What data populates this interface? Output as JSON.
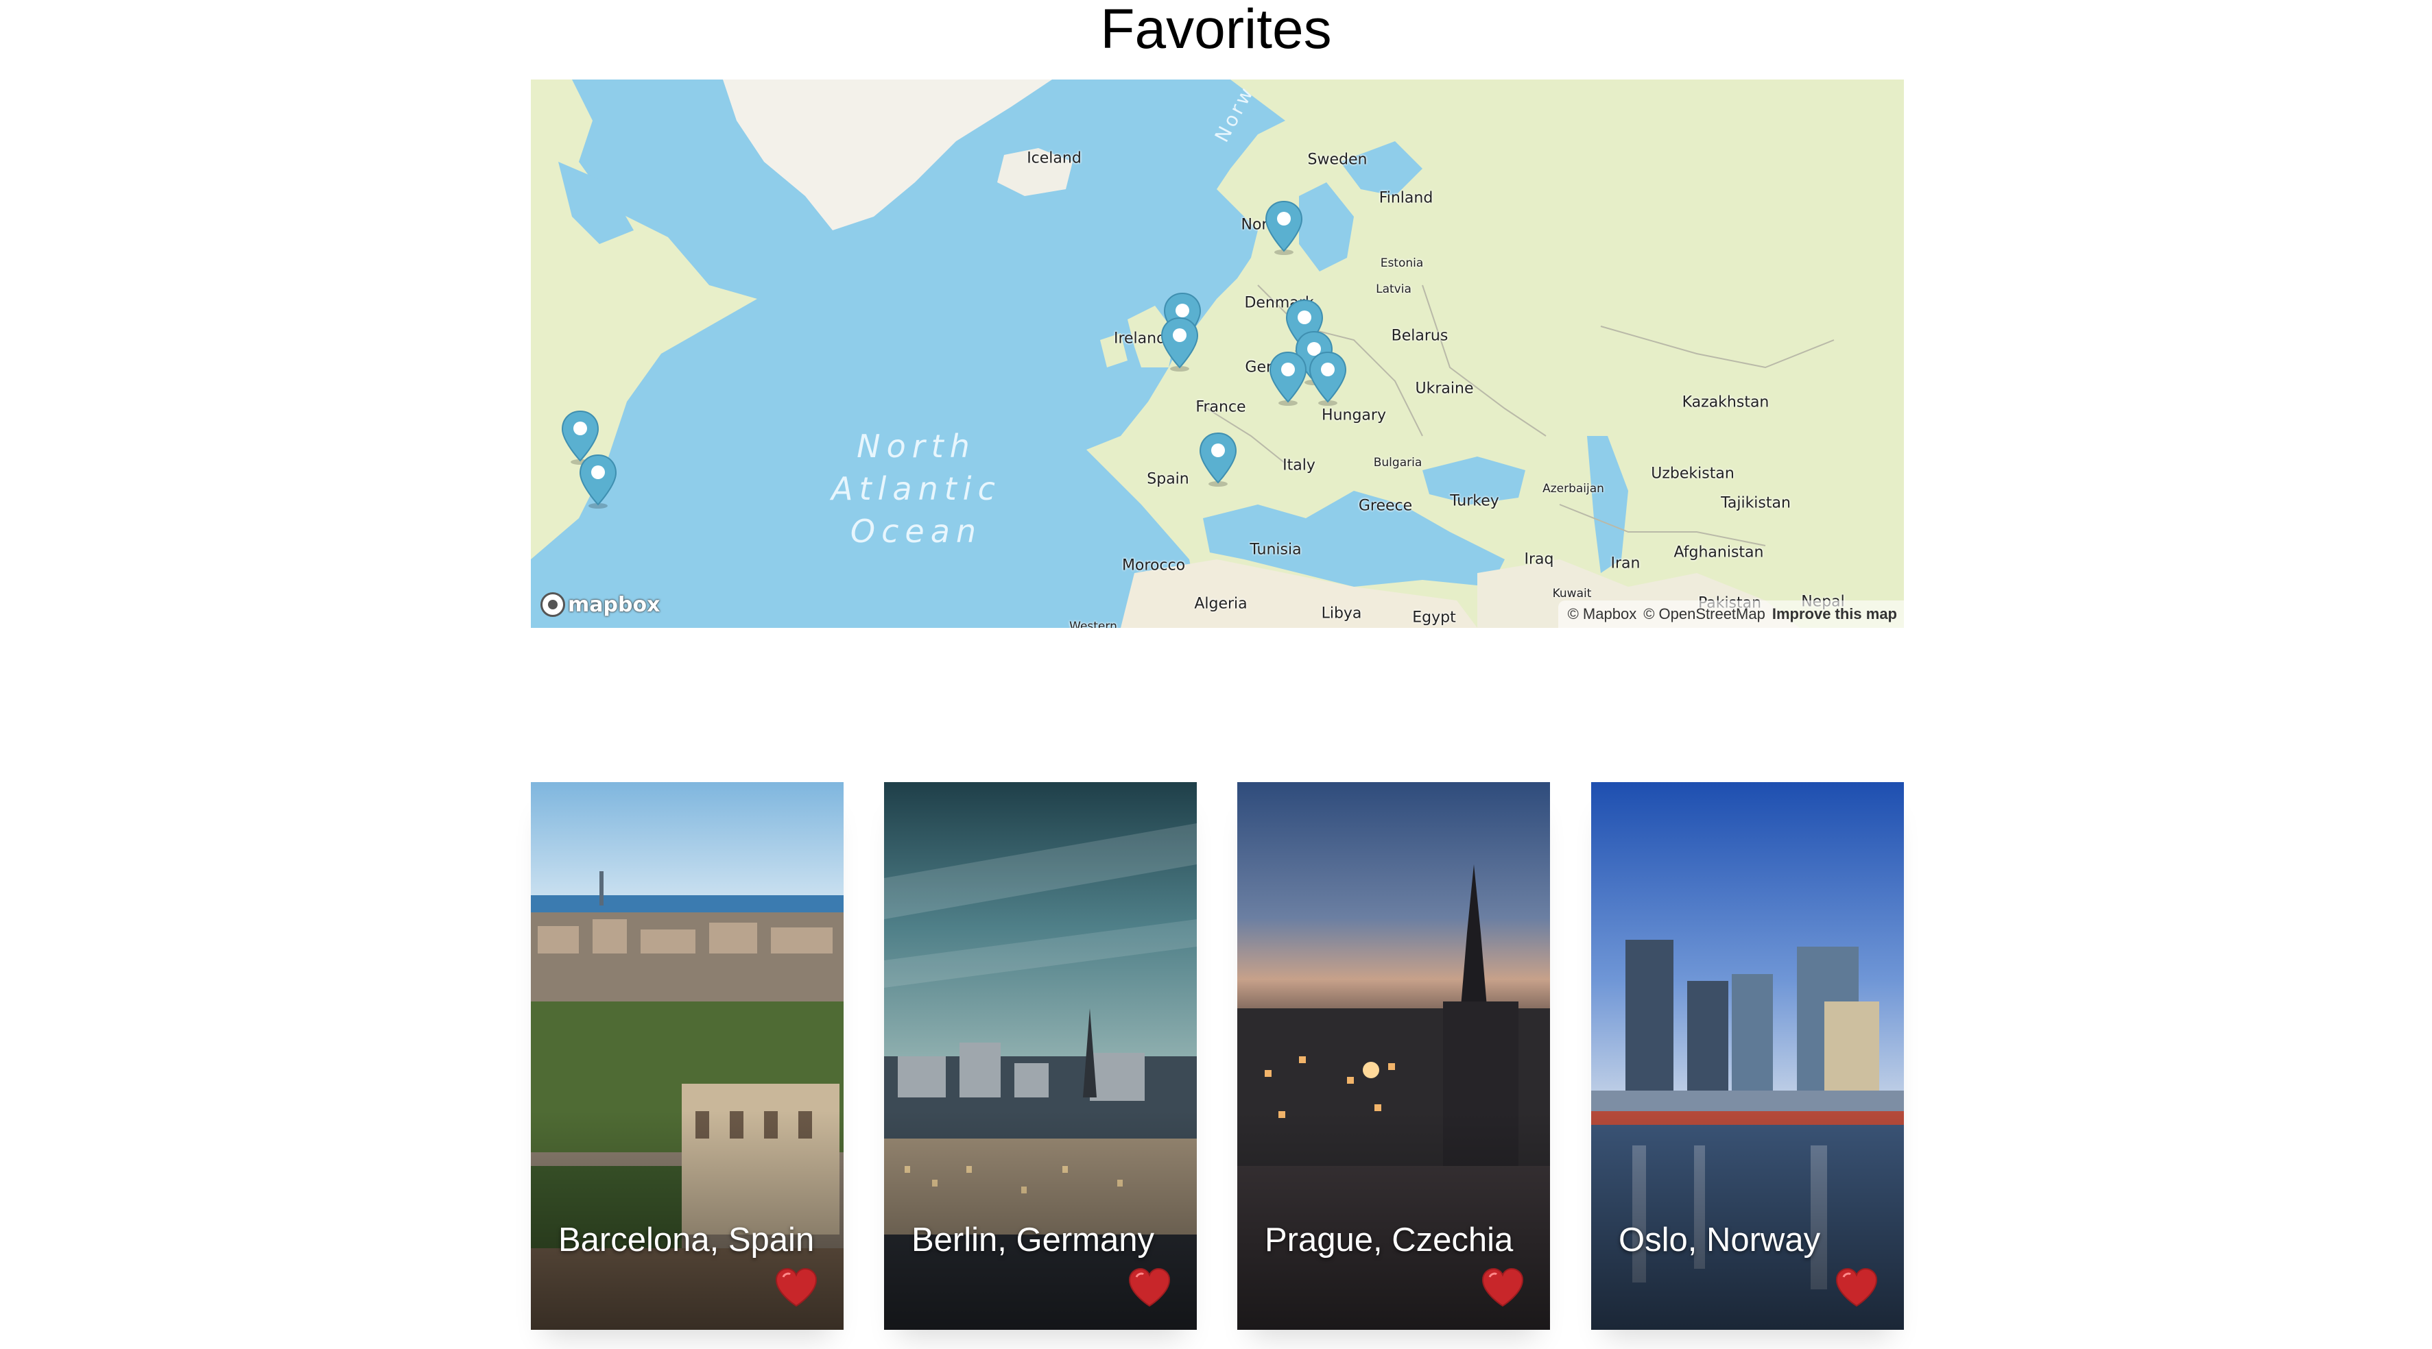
{
  "page": {
    "title": "Favorites"
  },
  "map": {
    "labels": {
      "iceland": "Iceland",
      "sweden": "Sweden",
      "finland": "Finland",
      "norway_partial": "Nor",
      "estonia": "Estonia",
      "latvia": "Latvia",
      "denmark": "Denmark",
      "ireland": "Ireland",
      "belarus": "Belarus",
      "germany_partial": "Gern",
      "ukraine": "Ukraine",
      "france": "France",
      "hungary": "Hungary",
      "kazakhstan": "Kazakhstan",
      "spain": "Spain",
      "italy": "Italy",
      "bulgaria": "Bulgaria",
      "azerbaijan": "Azerbaijan",
      "uzbekistan": "Uzbekistan",
      "tajikistan": "Tajikistan",
      "greece": "Greece",
      "turkey": "Turkey",
      "tunisia": "Tunisia",
      "iraq": "Iraq",
      "iran": "Iran",
      "afghanistan": "Afghanistan",
      "morocco": "Morocco",
      "algeria": "Algeria",
      "libya": "Libya",
      "egypt": "Egypt",
      "kuwait": "Kuwait",
      "pakistan": "Pakistan",
      "nepal": "Nepal",
      "western_partial": "Western",
      "norwegian_sea_partial": "Norw",
      "ocean_line1": "North",
      "ocean_line2": "Atlantic",
      "ocean_line3": "Ocean"
    },
    "logo_text": "mapbox",
    "attribution": {
      "mapbox": "© Mapbox",
      "osm": "© OpenStreetMap",
      "improve": "Improve this map"
    },
    "marker_color": "#5ab0d0"
  },
  "cards": [
    {
      "city": "Barcelona, Spain",
      "favorited": true
    },
    {
      "city": "Berlin, Germany",
      "favorited": true
    },
    {
      "city": "Prague, Czechia",
      "favorited": true
    },
    {
      "city": "Oslo, Norway",
      "favorited": true
    }
  ],
  "colors": {
    "heart": "#c8262a",
    "water": "#8fcdea",
    "land": "#e6eec8"
  }
}
